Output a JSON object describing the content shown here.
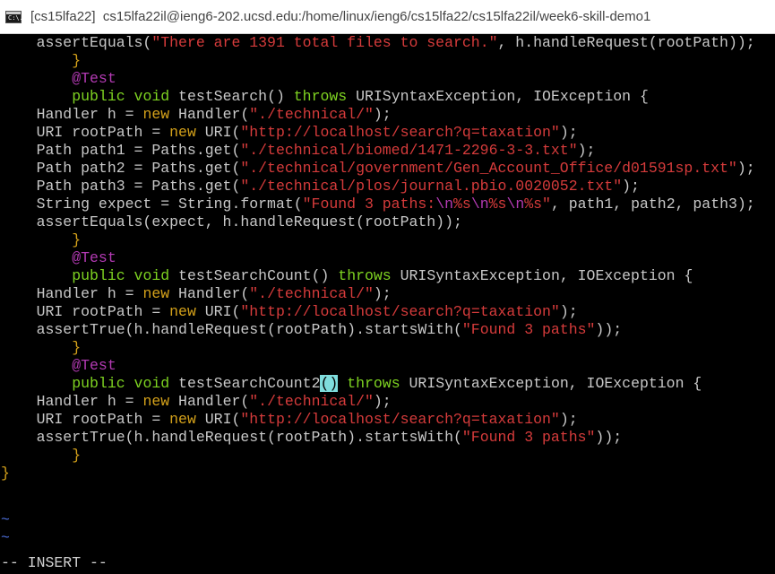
{
  "window": {
    "title_prefix": "[cs15lfa22]",
    "title_path": "cs15lfa22il@ieng6-202.ucsd.edu:/home/linux/ieng6/cs15lfa22/cs15lfa22il/week6-skill-demo1",
    "icon_text": "C:\\."
  },
  "code": {
    "l1_a": "    assertEquals(",
    "l1_str": "\"There are 1391 total files to search.\"",
    "l1_b": ", h.handleRequest(rootPath));",
    "brace_close": "        }",
    "ann": "@Test",
    "public": "public",
    "void": "void",
    "throws": "throws",
    "new": "new",
    "search_sig_a": " testSearch() ",
    "search_sig_b": " URISyntaxException, IOException {",
    "handler_a": "    Handler h = ",
    "handler_b": " Handler(",
    "handler_str": "\"./technical/\"",
    "paren_close": ");",
    "uri_a": "    URI rootPath = ",
    "uri_b": " URI(",
    "uri_str": "\"http://localhost/search?q=taxation\"",
    "path1_a": "    Path path1 = Paths.get(",
    "path1_str": "\"./technical/biomed/1471-2296-3-3.txt\"",
    "path2_a": "    Path path2 = Paths.get(",
    "path2_str": "\"./technical/government/Gen_Account_Office/d01591sp.txt\"",
    "path3_a": "    Path path3 = Paths.get(",
    "path3_str": "\"./technical/plos/journal.pbio.0020052.txt\"",
    "fmt_a": "    String expect = String.format(",
    "fmt_str1": "\"Found 3 paths:",
    "fmt_esc1": "\\n",
    "fmt_str2": "%s",
    "fmt_esc2": "\\n",
    "fmt_str3": "%s",
    "fmt_esc3": "\\n",
    "fmt_str4": "%s\"",
    "fmt_b": ", path1, path2, path3);",
    "assert_expect": "    assertEquals(expect, h.handleRequest(rootPath));",
    "count_sig_a": " testSearchCount() ",
    "count_sig_b": " URISyntaxException, IOException {",
    "assert_true_a": "    assertTrue(h.handleRequest(rootPath).startsWith(",
    "found_str": "\"Found 3 paths\"",
    "assert_true_b": "));",
    "count2_name": " testSearchCount2",
    "count2_cursor": "()",
    "count2_b": " URISyntaxException, IOException {",
    "final_brace": "}",
    "tilde": "~",
    "status": "-- INSERT --"
  }
}
